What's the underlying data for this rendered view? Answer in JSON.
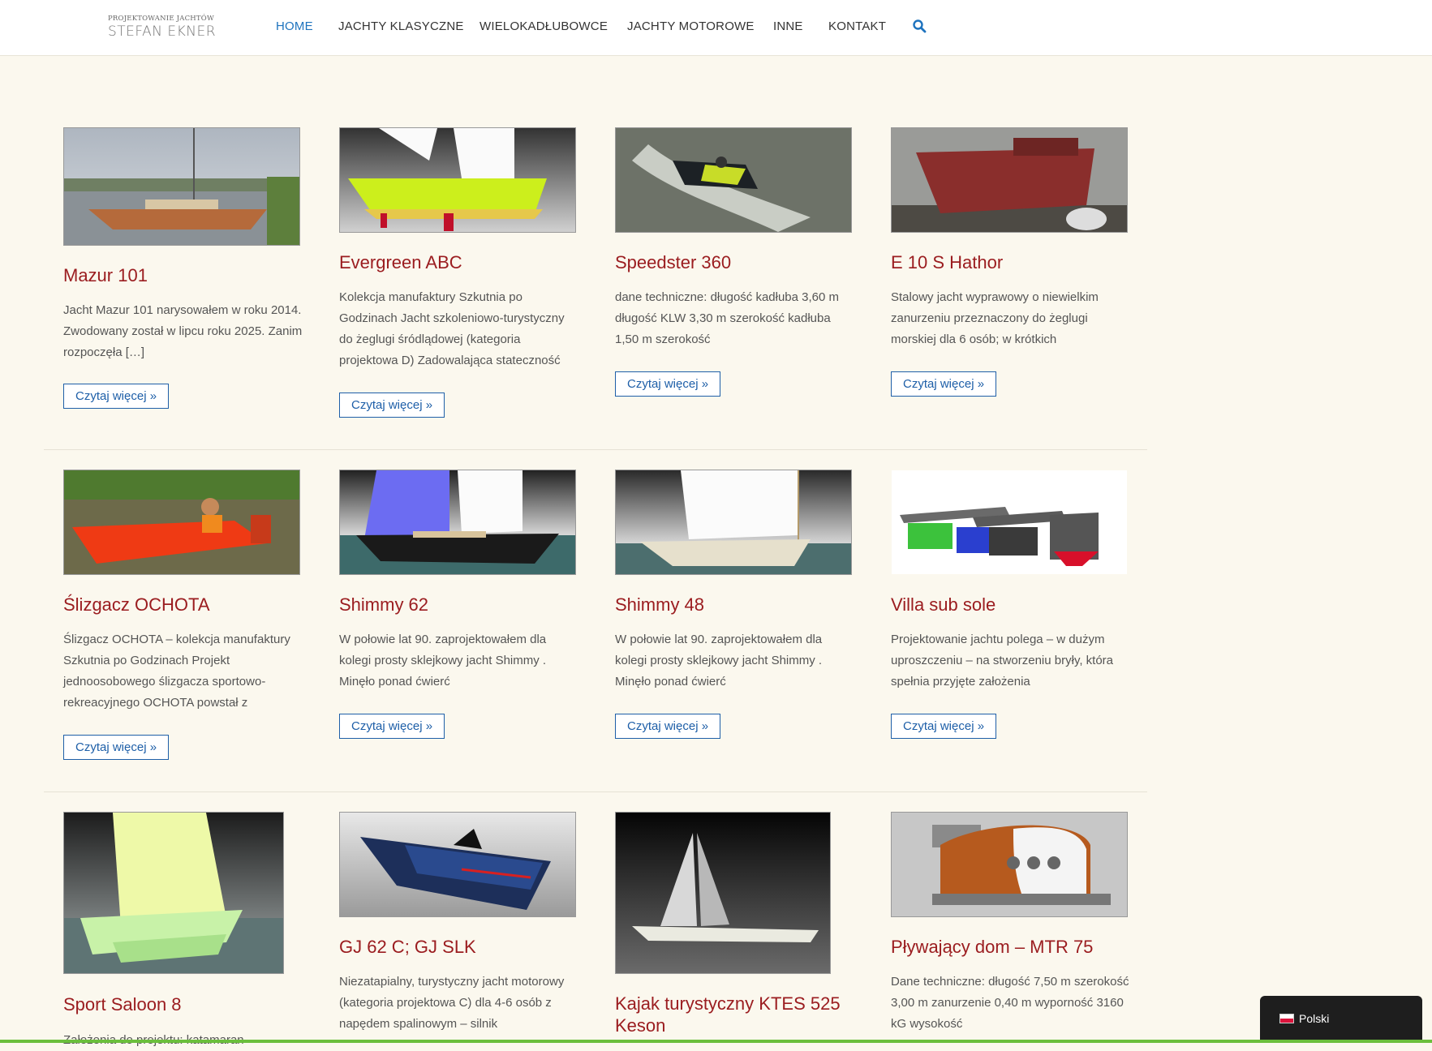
{
  "logo": {
    "small": "PROJEKTOWANIE JACHTÓW",
    "big": "STEFAN EKNER"
  },
  "nav": {
    "items": [
      "HOME",
      "JACHTY KLASYCZNE",
      "WIELOKADŁUBOWCE",
      "JACHTY MOTOROWE",
      "INNE",
      "KONTAKT"
    ],
    "active": "HOME"
  },
  "cards": [
    {
      "title": "Mazur 101",
      "excerpt": "Jacht Mazur 101 narysowałem w roku 2014. Zwodowany został w lipcu roku 2025. Zanim rozpoczęła […]",
      "more": "Czytaj więcej »"
    },
    {
      "title": "Evergreen ABC",
      "excerpt": "Kolekcja manufaktury Szkutnia po Godzinach Jacht szkoleniowo-turystyczny do żeglugi śródlądowej (kategoria projektowa D) Zadowalająca stateczność",
      "more": "Czytaj więcej »"
    },
    {
      "title": "Speedster 360",
      "excerpt": "dane techniczne: długość kadłuba 3,60 m długość KLW 3,30 m szerokość kadłuba 1,50 m szerokość",
      "more": "Czytaj więcej »"
    },
    {
      "title": "E 10 S Hathor",
      "excerpt": "Stalowy jacht wyprawowy o niewielkim zanurzeniu przeznaczony do żeglugi morskiej dla 6 osób; w krótkich",
      "more": "Czytaj więcej »"
    },
    {
      "title": "Ślizgacz OCHOTA",
      "excerpt": "Ślizgacz OCHOTA – kolekcja manufaktury Szkutnia po Godzinach Projekt jednoosobowego ślizgacza sportowo-rekreacyjnego OCHOTA powstał z",
      "more": "Czytaj więcej »"
    },
    {
      "title": "Shimmy 62",
      "excerpt": "W połowie lat 90. zaprojektowałem dla kolegi prosty sklejkowy jacht Shimmy . Minęło ponad ćwierć",
      "more": "Czytaj więcej »"
    },
    {
      "title": "Shimmy 48",
      "excerpt": "W połowie lat 90. zaprojektowałem dla kolegi prosty sklejkowy jacht Shimmy . Minęło ponad ćwierć",
      "more": "Czytaj więcej »"
    },
    {
      "title": "Villa sub sole",
      "excerpt": "Projektowanie jachtu polega – w dużym uproszczeniu – na stworzeniu bryły, która spełnia przyjęte założenia",
      "more": "Czytaj więcej »"
    },
    {
      "title": "Sport Saloon 8",
      "excerpt": "Założenia do projektu: katamaran",
      "more": ""
    },
    {
      "title": "GJ 62 C; GJ SLK",
      "excerpt": "Niezatapialny, turystyczny jacht motorowy (kategoria projektowa C) dla 4-6 osób z napędem spalinowym – silnik",
      "more": ""
    },
    {
      "title": "Kajak turystyczny KTES 525 Keson",
      "excerpt": "",
      "more": ""
    },
    {
      "title": "Pływający dom – MTR 75",
      "excerpt": "Dane techniczne: długość 7,50 m szerokość 3,00 m zanurzenie 0,40 m wyporność 3160 kG wysokość",
      "more": ""
    }
  ],
  "language": {
    "label": "Polski"
  },
  "colors": {
    "accent": "#1e73be",
    "title": "#9b1d20",
    "background": "#fbf8ee",
    "button": "#1e5fa8"
  }
}
